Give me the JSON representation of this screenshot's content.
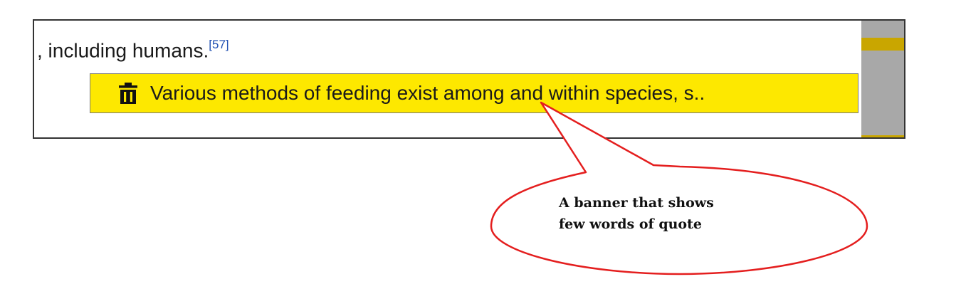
{
  "article": {
    "text": ", including humans.",
    "citation": "[57]"
  },
  "banner": {
    "icon": "trash-icon",
    "text": "Various methods of feeding exist among and within species, s..",
    "color": "#fde800"
  },
  "callout": {
    "line1": "A banner that shows",
    "line2": "few words of quote",
    "stroke": "#e41e1e"
  },
  "scrollbar": {
    "marker_color": "#c9a600"
  }
}
